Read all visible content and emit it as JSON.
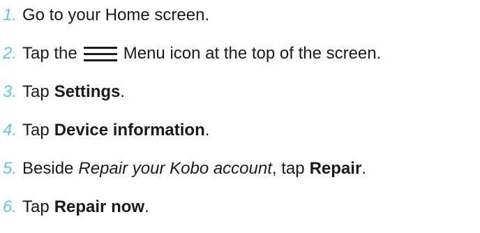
{
  "steps": [
    {
      "number": "1.",
      "segments": [
        {
          "text": "Go to your Home screen."
        }
      ]
    },
    {
      "number": "2.",
      "segments": [
        {
          "text": "Tap the"
        },
        {
          "icon": "menu-icon"
        },
        {
          "text": "Menu icon at the top of the screen."
        }
      ]
    },
    {
      "number": "3.",
      "segments": [
        {
          "text": "Tap"
        },
        {
          "text": "Settings",
          "style": "bold"
        },
        {
          "text": "."
        }
      ]
    },
    {
      "number": "4.",
      "segments": [
        {
          "text": "Tap"
        },
        {
          "text": "Device information",
          "style": "bold"
        },
        {
          "text": "."
        }
      ]
    },
    {
      "number": "5.",
      "segments": [
        {
          "text": "Beside"
        },
        {
          "text": "Repair your Kobo account",
          "style": "italic"
        },
        {
          "text": ", tap"
        },
        {
          "text": "Repair",
          "style": "bold"
        },
        {
          "text": "."
        }
      ]
    },
    {
      "number": "6.",
      "segments": [
        {
          "text": "Tap"
        },
        {
          "text": "Repair now",
          "style": "bold"
        },
        {
          "text": "."
        }
      ]
    }
  ],
  "colors": {
    "step_number": "#5fc8e3",
    "text": "#1a1a1a"
  }
}
